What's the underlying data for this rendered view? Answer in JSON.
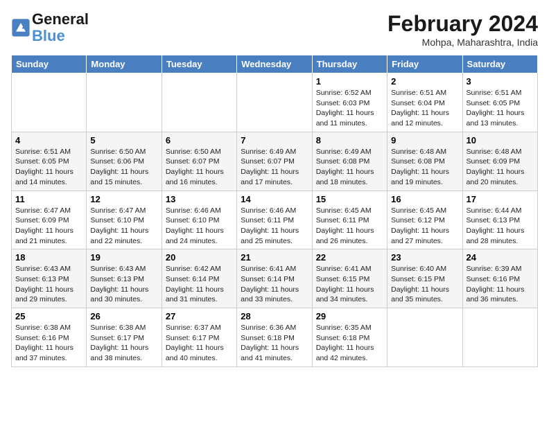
{
  "header": {
    "logo_line1": "General",
    "logo_line2": "Blue",
    "month_title": "February 2024",
    "location": "Mohpa, Maharashtra, India"
  },
  "days_of_week": [
    "Sunday",
    "Monday",
    "Tuesday",
    "Wednesday",
    "Thursday",
    "Friday",
    "Saturday"
  ],
  "weeks": [
    [
      {
        "day": "",
        "info": ""
      },
      {
        "day": "",
        "info": ""
      },
      {
        "day": "",
        "info": ""
      },
      {
        "day": "",
        "info": ""
      },
      {
        "day": "1",
        "info": "Sunrise: 6:52 AM\nSunset: 6:03 PM\nDaylight: 11 hours and 11 minutes."
      },
      {
        "day": "2",
        "info": "Sunrise: 6:51 AM\nSunset: 6:04 PM\nDaylight: 11 hours and 12 minutes."
      },
      {
        "day": "3",
        "info": "Sunrise: 6:51 AM\nSunset: 6:05 PM\nDaylight: 11 hours and 13 minutes."
      }
    ],
    [
      {
        "day": "4",
        "info": "Sunrise: 6:51 AM\nSunset: 6:05 PM\nDaylight: 11 hours and 14 minutes."
      },
      {
        "day": "5",
        "info": "Sunrise: 6:50 AM\nSunset: 6:06 PM\nDaylight: 11 hours and 15 minutes."
      },
      {
        "day": "6",
        "info": "Sunrise: 6:50 AM\nSunset: 6:07 PM\nDaylight: 11 hours and 16 minutes."
      },
      {
        "day": "7",
        "info": "Sunrise: 6:49 AM\nSunset: 6:07 PM\nDaylight: 11 hours and 17 minutes."
      },
      {
        "day": "8",
        "info": "Sunrise: 6:49 AM\nSunset: 6:08 PM\nDaylight: 11 hours and 18 minutes."
      },
      {
        "day": "9",
        "info": "Sunrise: 6:48 AM\nSunset: 6:08 PM\nDaylight: 11 hours and 19 minutes."
      },
      {
        "day": "10",
        "info": "Sunrise: 6:48 AM\nSunset: 6:09 PM\nDaylight: 11 hours and 20 minutes."
      }
    ],
    [
      {
        "day": "11",
        "info": "Sunrise: 6:47 AM\nSunset: 6:09 PM\nDaylight: 11 hours and 21 minutes."
      },
      {
        "day": "12",
        "info": "Sunrise: 6:47 AM\nSunset: 6:10 PM\nDaylight: 11 hours and 22 minutes."
      },
      {
        "day": "13",
        "info": "Sunrise: 6:46 AM\nSunset: 6:10 PM\nDaylight: 11 hours and 24 minutes."
      },
      {
        "day": "14",
        "info": "Sunrise: 6:46 AM\nSunset: 6:11 PM\nDaylight: 11 hours and 25 minutes."
      },
      {
        "day": "15",
        "info": "Sunrise: 6:45 AM\nSunset: 6:11 PM\nDaylight: 11 hours and 26 minutes."
      },
      {
        "day": "16",
        "info": "Sunrise: 6:45 AM\nSunset: 6:12 PM\nDaylight: 11 hours and 27 minutes."
      },
      {
        "day": "17",
        "info": "Sunrise: 6:44 AM\nSunset: 6:13 PM\nDaylight: 11 hours and 28 minutes."
      }
    ],
    [
      {
        "day": "18",
        "info": "Sunrise: 6:43 AM\nSunset: 6:13 PM\nDaylight: 11 hours and 29 minutes."
      },
      {
        "day": "19",
        "info": "Sunrise: 6:43 AM\nSunset: 6:13 PM\nDaylight: 11 hours and 30 minutes."
      },
      {
        "day": "20",
        "info": "Sunrise: 6:42 AM\nSunset: 6:14 PM\nDaylight: 11 hours and 31 minutes."
      },
      {
        "day": "21",
        "info": "Sunrise: 6:41 AM\nSunset: 6:14 PM\nDaylight: 11 hours and 33 minutes."
      },
      {
        "day": "22",
        "info": "Sunrise: 6:41 AM\nSunset: 6:15 PM\nDaylight: 11 hours and 34 minutes."
      },
      {
        "day": "23",
        "info": "Sunrise: 6:40 AM\nSunset: 6:15 PM\nDaylight: 11 hours and 35 minutes."
      },
      {
        "day": "24",
        "info": "Sunrise: 6:39 AM\nSunset: 6:16 PM\nDaylight: 11 hours and 36 minutes."
      }
    ],
    [
      {
        "day": "25",
        "info": "Sunrise: 6:38 AM\nSunset: 6:16 PM\nDaylight: 11 hours and 37 minutes."
      },
      {
        "day": "26",
        "info": "Sunrise: 6:38 AM\nSunset: 6:17 PM\nDaylight: 11 hours and 38 minutes."
      },
      {
        "day": "27",
        "info": "Sunrise: 6:37 AM\nSunset: 6:17 PM\nDaylight: 11 hours and 40 minutes."
      },
      {
        "day": "28",
        "info": "Sunrise: 6:36 AM\nSunset: 6:18 PM\nDaylight: 11 hours and 41 minutes."
      },
      {
        "day": "29",
        "info": "Sunrise: 6:35 AM\nSunset: 6:18 PM\nDaylight: 11 hours and 42 minutes."
      },
      {
        "day": "",
        "info": ""
      },
      {
        "day": "",
        "info": ""
      }
    ]
  ]
}
